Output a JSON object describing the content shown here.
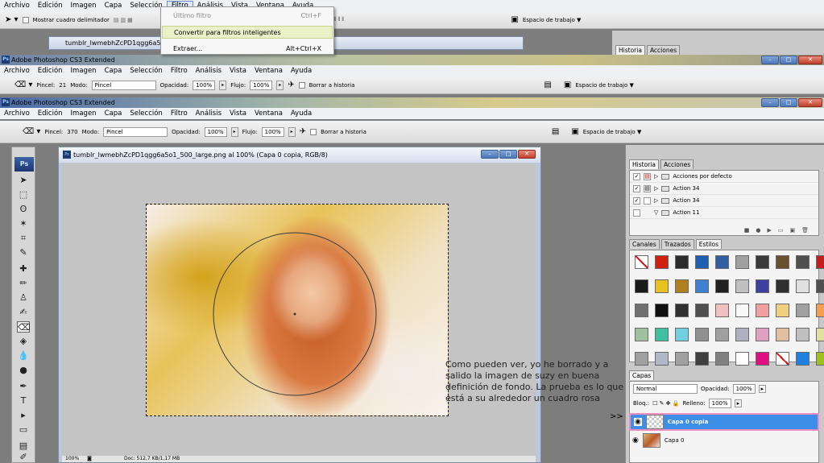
{
  "app_title": "Adobe Photoshop CS3 Extended",
  "menu": [
    "Archivo",
    "Edición",
    "Imagen",
    "Capa",
    "Selección",
    "Filtro",
    "Análisis",
    "Vista",
    "Ventana",
    "Ayuda"
  ],
  "top_toolbar": {
    "show_bounding_box": "Mostrar cuadro delimitador",
    "workspace": "Espacio de trabajo ▼"
  },
  "filter_menu": {
    "items": [
      {
        "label": "Último filtro",
        "shortcut": "Ctrl+F"
      },
      {
        "label": "Convertir para filtros inteligentes",
        "shortcut": ""
      },
      {
        "label": "Extraer...",
        "shortcut": "Alt+Ctrl+X"
      }
    ]
  },
  "options_bar_back": {
    "brush_label": "Pincel:",
    "brush_size": "21",
    "mode_label": "Modo:",
    "mode_value": "Pincel",
    "opacity_label": "Opacidad:",
    "opacity_value": "100%",
    "flow_label": "Flujo:",
    "flow_value": "100%",
    "erase_history": "Borrar a historia",
    "workspace": "Espacio de trabajo ▼"
  },
  "options_bar_front": {
    "brush_label": "Pincel:",
    "brush_size": "370",
    "mode_label": "Modo:",
    "mode_value": "Pincel",
    "opacity_label": "Opacidad:",
    "opacity_value": "100%",
    "flow_label": "Flujo:",
    "flow_value": "100%",
    "erase_history": "Borrar a historia",
    "workspace": "Espacio de trabajo ▼"
  },
  "back_doc_title": "tumblr_lwmebhZcPD1qgg6a5",
  "document": {
    "title": "tumblr_lwmebhZcPD1qgg6a5o1_500_large.png al 100% (Capa 0 copia, RGB/8)",
    "zoom": "100%",
    "doc_size": "Doc: 512,7 KB/1,17 MB"
  },
  "history_panel": {
    "tabs": [
      "Historia",
      "Acciones"
    ],
    "actions": [
      "Acciones por defecto",
      "Action 34",
      "Action 34",
      "Action 11"
    ]
  },
  "back_history_tabs": [
    "Historia",
    "Acciones"
  ],
  "styles_panel": {
    "tabs": [
      "Canales",
      "Trazados",
      "Estilos"
    ],
    "swatches": [
      "#c8c8c8",
      "#d02010",
      "#2b2b2b",
      "#2060b0",
      "#3060a0",
      "#a0a0a0",
      "#3a3a3a",
      "#6a5030",
      "#505050",
      "#c02020",
      "#1a1a1a",
      "#e8c020",
      "#b08020",
      "#4080d0",
      "#202020",
      "#c0c0c0",
      "#4040a0",
      "#303030",
      "#e0e0e0",
      "#505050",
      "#707070",
      "#101010",
      "#303030",
      "#505050",
      "#f0c0c0",
      "#f8f8f8",
      "#f0a0a0",
      "#f0d080",
      "#a0a0a0",
      "#f0a050",
      "#a0c0a0",
      "#40c0a0",
      "#70d0e0",
      "#909090",
      "#a0a0a0",
      "#b0b0c0",
      "#e0a0c0",
      "#e0c0a0",
      "#c0c0c0",
      "#e0e0a0",
      "#a0a0a0",
      "#b0b8c8",
      "#a0a0a0",
      "#404040",
      "#808080",
      "#ffffff",
      "#e01080",
      "#c020c0",
      "#2080e0",
      "#a0c020"
    ]
  },
  "layers_panel": {
    "tab": "Capas",
    "blend_mode": "Normal",
    "opacity_label": "Opacidad:",
    "opacity_value": "100%",
    "lock_label": "Bloq.:",
    "fill_label": "Relleno:",
    "fill_value": "100%",
    "layers": [
      {
        "name": "Capa 0 copia",
        "selected": true
      },
      {
        "name": "Capa 0",
        "selected": false
      }
    ]
  },
  "annotation": "Como pueden ver, yo he borrado y a salido la imagen de suzy en buena definición de fondo. La prueba es lo que está a su alrededor un cuadro rosa",
  "annotation_arrow": ">>",
  "colors": {
    "selected_layer": "#3d8ee6",
    "highlight_box": "#f08cc0"
  }
}
